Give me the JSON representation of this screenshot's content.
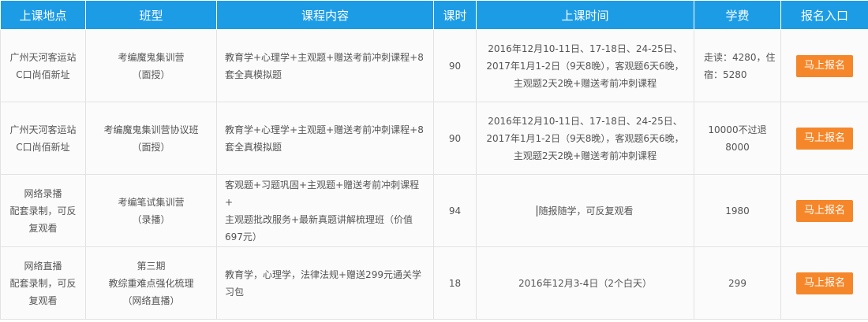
{
  "headers": [
    "上课地点",
    "班型",
    "课程内容",
    "课时",
    "上课时间",
    "学费",
    "报名入口"
  ],
  "rows": [
    {
      "location": [
        "广州天河客运站",
        "C口尚佰新址"
      ],
      "class_type": [
        "考编魔鬼集训营",
        "（面授）"
      ],
      "content": [
        "教育学+心理学+主观题+赠送考前冲刺课程+8",
        "套全真模拟题"
      ],
      "hours": "90",
      "time": [
        "2016年12月10-11日、17-18日、24-25日、",
        "2017年1月1-2日（9天8晚），客观题6天6晚，",
        "主观题2天2晚+赠送考前冲刺课程"
      ],
      "fee": [
        "走读：4280，住",
        "宿：5280"
      ],
      "button": "马上报名"
    },
    {
      "location": [
        "广州天河客运站",
        "C口尚佰新址"
      ],
      "class_type": [
        "考编魔鬼集训营协议班",
        "（面授）"
      ],
      "content": [
        "教育学+心理学+主观题+赠送考前冲刺课程+8",
        "套全真模拟题"
      ],
      "hours": "90",
      "time": [
        "2016年12月10-11日、17-18日、24-25日、",
        "2017年1月1-2日（9天8晚），客观题6天6晚，",
        "主观题2天2晚+赠送考前冲刺课程"
      ],
      "fee": [
        "10000不过退",
        "8000"
      ],
      "button": "马上报名"
    },
    {
      "location": [
        "网络录播",
        "配套录制，可反",
        "复观看"
      ],
      "class_type": [
        "考编笔试集训营",
        "（录播）"
      ],
      "content": [
        "客观题+习题巩固+主观题+赠送考前冲刺课程+",
        "主观题批改服务+最新真题讲解梳理班（价值",
        "697元）"
      ],
      "hours": "94",
      "time": [
        "随报随学，可反复观看"
      ],
      "fee": [
        "1980"
      ],
      "button": "马上报名"
    },
    {
      "location": [
        "网络直播",
        "配套录制，可反",
        "复观看"
      ],
      "class_type": [
        "第三期",
        "教综重难点强化梳理",
        "（网络直播）"
      ],
      "content": [
        "教育学，心理学，法律法规+赠送299元通关学",
        "习包"
      ],
      "hours": "18",
      "time": [
        "2016年12月3-4日（2个白天）"
      ],
      "fee": [
        "299"
      ],
      "button": "马上报名"
    }
  ],
  "colors": {
    "header_bg": "#1d9ce6",
    "button_bg": "#f5872a"
  }
}
